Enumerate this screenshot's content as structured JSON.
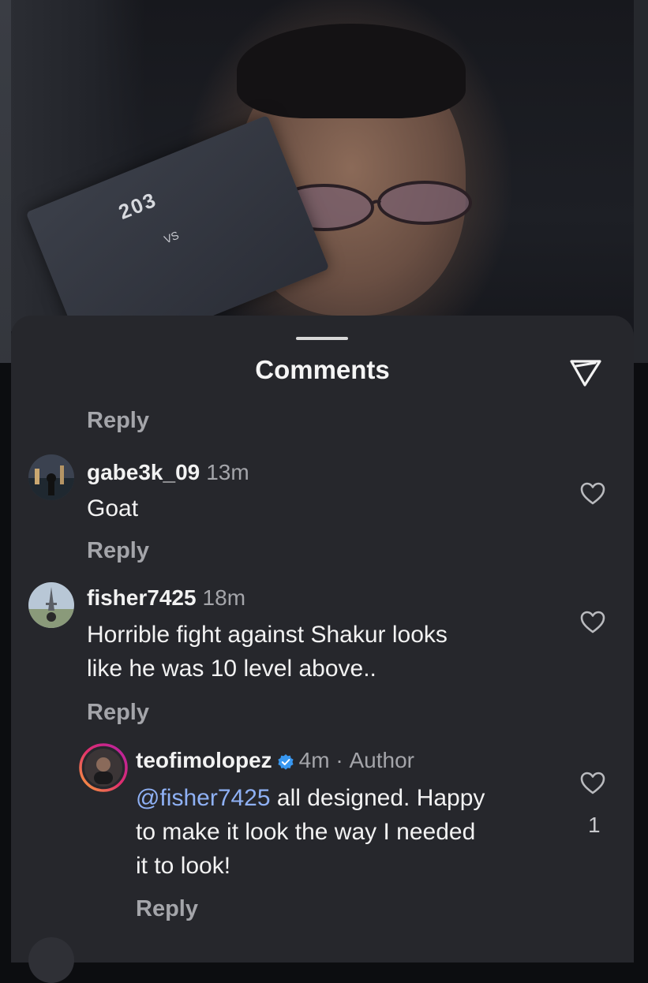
{
  "sheet": {
    "title": "Comments",
    "send_icon": "send-icon"
  },
  "photo": {
    "program_title": "203",
    "program_vs": "VS"
  },
  "comments": [
    {
      "reply_label": "Reply"
    },
    {
      "username": "gabe3k_09",
      "time": "13m",
      "text": "Goat",
      "reply_label": "Reply"
    },
    {
      "username": "fisher7425",
      "time": "18m",
      "text_line1": "Horrible fight against Shakur looks",
      "text_line2": "like he was 10 level above..",
      "reply_label": "Reply"
    },
    {
      "username": "teofimolopez",
      "time": "4m",
      "separator": "·",
      "badge": "Author",
      "mention": "@fisher7425",
      "text_line1": " all designed. Happy",
      "text_line2": "to make it look the way I needed",
      "text_line3": "it to look!",
      "like_count": "1",
      "reply_label": "Reply"
    }
  ],
  "colors": {
    "sheet_bg": "#26272c",
    "muted_text": "#a4a5aa",
    "mention": "#8fb1f5",
    "verified": "#3897f0"
  }
}
